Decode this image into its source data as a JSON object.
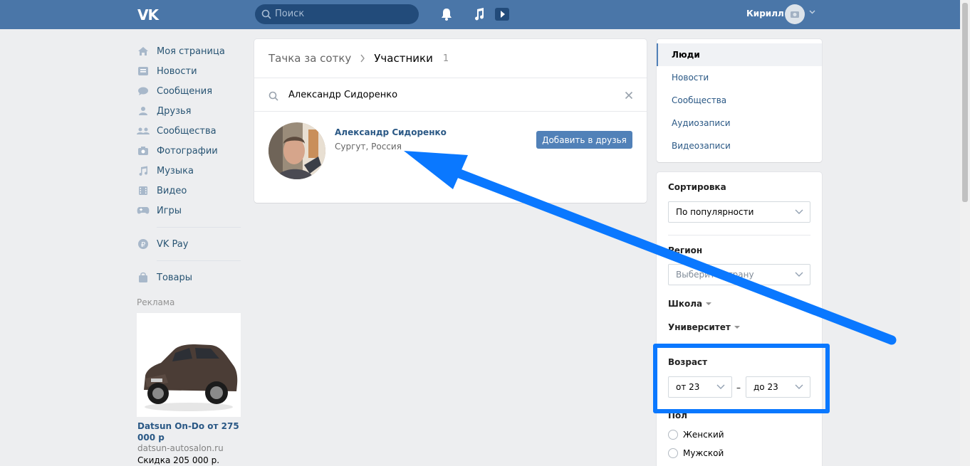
{
  "header": {
    "logo": "VK",
    "search_placeholder": "Поиск",
    "user_name": "Кирилл"
  },
  "sidebar": {
    "items": [
      {
        "label": "Моя страница",
        "icon": "home-icon"
      },
      {
        "label": "Новости",
        "icon": "news-icon"
      },
      {
        "label": "Сообщения",
        "icon": "messages-icon"
      },
      {
        "label": "Друзья",
        "icon": "friends-icon"
      },
      {
        "label": "Сообщества",
        "icon": "groups-icon"
      },
      {
        "label": "Фотографии",
        "icon": "camera-icon"
      },
      {
        "label": "Музыка",
        "icon": "music-icon"
      },
      {
        "label": "Видео",
        "icon": "video-icon"
      },
      {
        "label": "Игры",
        "icon": "gamepad-icon"
      }
    ],
    "vkpay": "VK Pay",
    "goods": "Товары",
    "ads_label": "Реклама",
    "ad": {
      "title": "Datsun On-Do от 275 000 р",
      "domain": "datsun-autosalon.ru",
      "price": "Скидка 205 000 р."
    }
  },
  "main": {
    "breadcrumb_group": "Тачка за сотку",
    "breadcrumb_current": "Участники",
    "count": "1",
    "search_query": "Александр Сидоренко",
    "result": {
      "name": "Александр Сидоренко",
      "location": "Сургут, Россия",
      "add_button": "Добавить в друзья"
    }
  },
  "right_tabs": [
    "Люди",
    "Новости",
    "Сообщества",
    "Аудиозаписи",
    "Видеозаписи"
  ],
  "filters": {
    "sort_label": "Сортировка",
    "sort_value": "По популярности",
    "region_label": "Регион",
    "region_placeholder": "Выберите страну",
    "school_label": "Школа",
    "university_label": "Университет",
    "age_label": "Возраст",
    "age_from": "от 23",
    "age_dash": "–",
    "age_to": "до 23",
    "gender_label": "Пол",
    "gender_options": [
      "Женский",
      "Мужской"
    ]
  },
  "colors": {
    "header_bg": "#4a76a8",
    "link": "#2a5885",
    "button": "#5181b8",
    "annotation": "#0a78ff"
  }
}
